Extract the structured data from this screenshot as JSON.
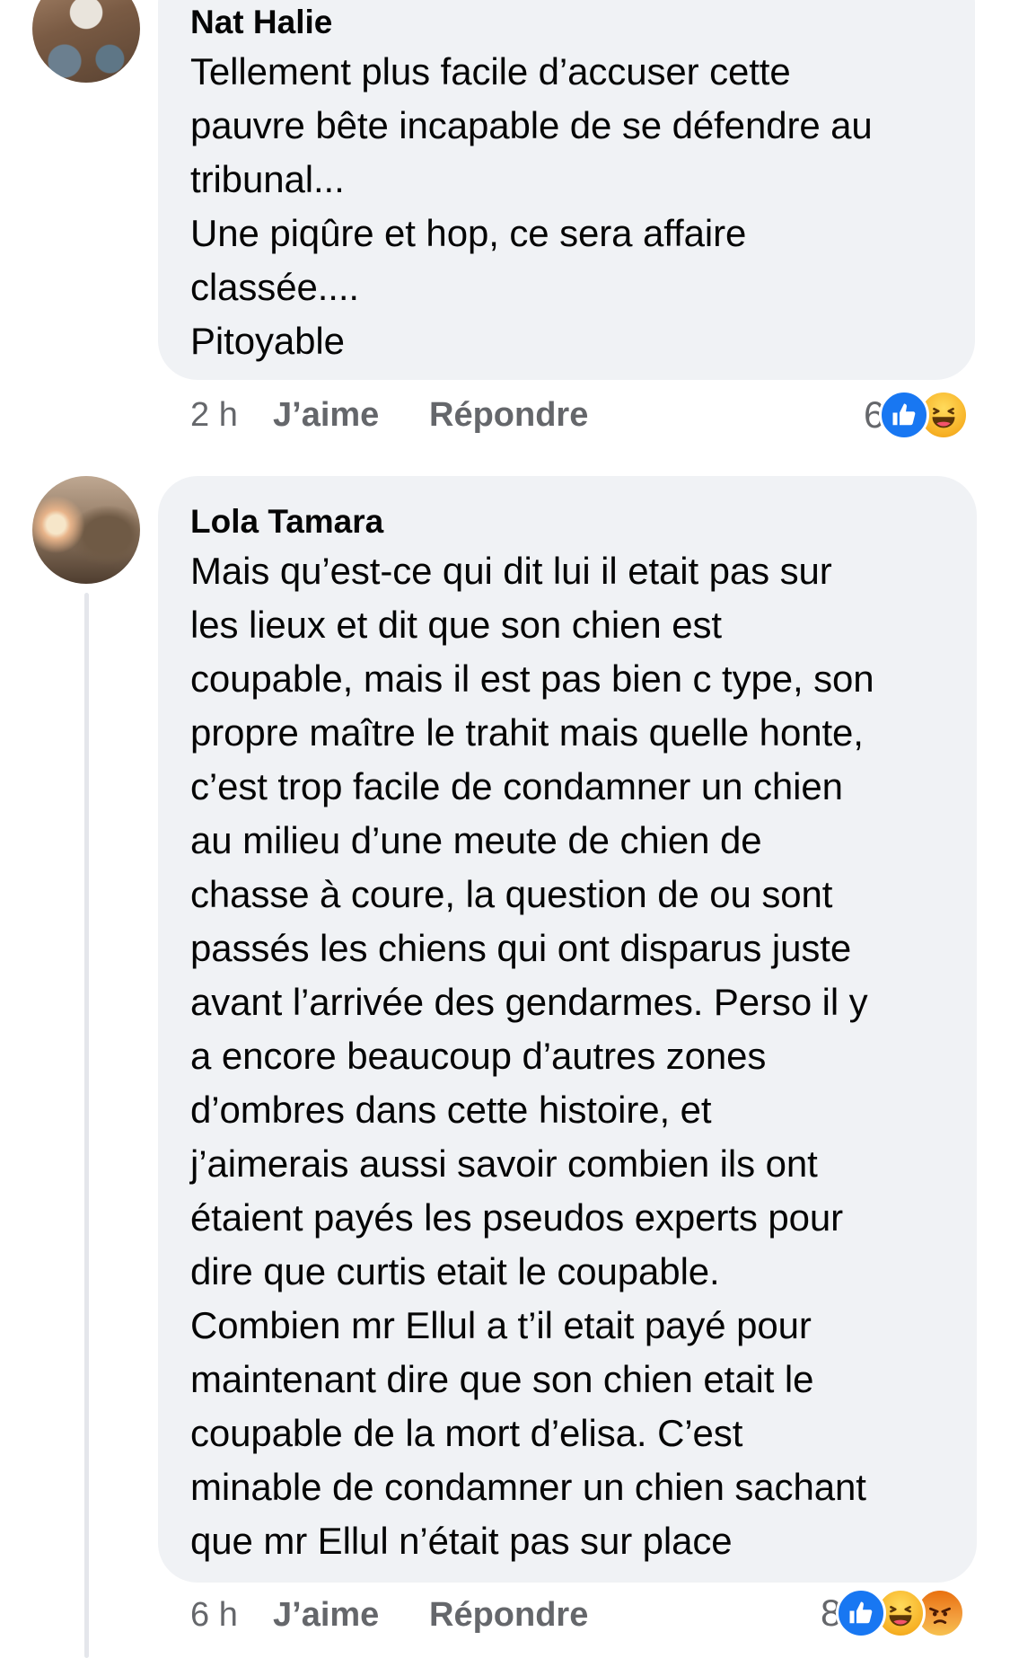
{
  "comments": [
    {
      "author": "Nat Halie",
      "text": "Tellement plus facile d’accuser cette\npauvre bête incapable de se défendre au\ntribunal...\nUne piqûre et hop, ce sera affaire\nclassée....\nPitoyable",
      "time": "2 h",
      "like_label": "J’aime",
      "reply_label": "Répondre",
      "reaction_count": "6",
      "reactions": [
        "like-icon",
        "haha-icon"
      ]
    },
    {
      "author": "Lola Tamara",
      "text": "Mais qu’est-ce qui dit lui il etait pas sur\nles lieux et dit que son chien est\ncoupable, mais il est pas bien c type, son\npropre maître le trahit mais quelle honte,\nc’est trop facile de condamner un chien\nau milieu d’une meute de chien de\nchasse à coure, la question de ou sont\npassés les chiens qui ont disparus juste\navant l’arrivée des gendarmes. Perso il y\na encore beaucoup d’autres zones\nd’ombres dans cette histoire, et\nj’aimerais aussi savoir combien ils ont\nétaient payés les pseudos experts pour\ndire que curtis etait le coupable.\nCombien mr Ellul a t’il etait payé pour\nmaintenant dire que son chien etait le\ncoupable de la mort d’elisa. C’est\nminable de condamner un chien sachant\nque mr Ellul n’était pas sur place",
      "time": "6 h",
      "like_label": "J’aime",
      "reply_label": "Répondre",
      "reaction_count": "8",
      "reactions": [
        "like-icon",
        "haha-icon",
        "angry-icon"
      ]
    }
  ],
  "colors": {
    "bubble": "#f0f2f5",
    "meta_text": "#65676b",
    "like_blue": "#1877f2"
  }
}
